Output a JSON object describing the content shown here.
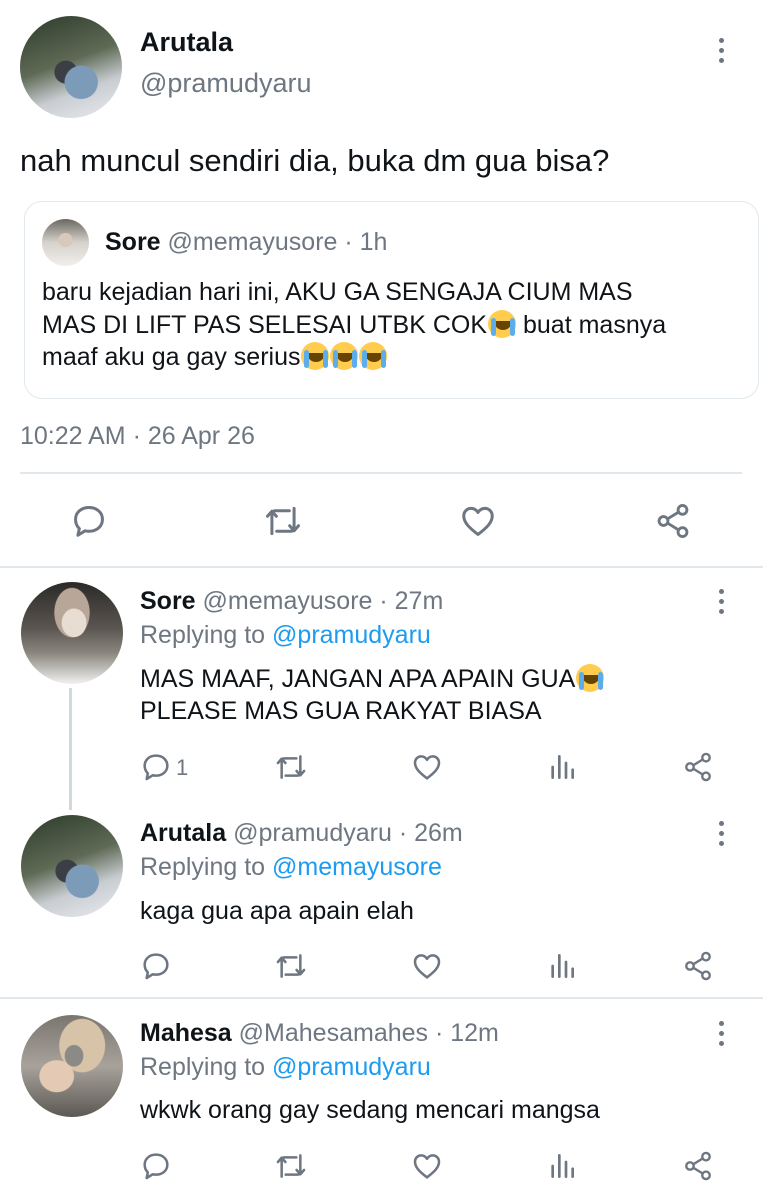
{
  "main_tweet": {
    "display_name": "Arutala",
    "handle": "@pramudyaru",
    "text": "nah muncul sendiri dia, buka dm gua bisa?",
    "quoted": {
      "display_name": "Sore",
      "handle_time": "@memayusore · 1h",
      "line1": "baru kejadian hari ini, AKU GA SENGAJA CIUM MAS",
      "line2a": "MAS DI LIFT PAS SELESAI UTBK COK",
      "line2b": " buat masnya",
      "line3": "maaf aku ga gay serius"
    },
    "timestamp": "10:22 AM · 26 Apr 26"
  },
  "replies": [
    {
      "display_name": "Sore",
      "handle_time": "@memayusore · 27m",
      "replying_prefix": "Replying to ",
      "replying_to": "@pramudyaru",
      "line1": "MAS MAAF, JANGAN APA APAIN GUA",
      "line2": "PLEASE MAS GUA RAKYAT BIASA",
      "reply_count": "1"
    },
    {
      "display_name": "Arutala",
      "handle_time": "@pramudyaru · 26m",
      "replying_prefix": "Replying to ",
      "replying_to": "@memayusore",
      "line1": "kaga gua apa apain elah"
    },
    {
      "display_name": "Mahesa",
      "handle_time": "@Mahesamahes · 12m",
      "replying_prefix": "Replying to ",
      "replying_to": "@pramudyaru",
      "line1": "wkwk orang gay sedang mencari mangsa"
    }
  ],
  "icons": {
    "reply": "comment-icon",
    "retweet": "retweet-icon",
    "like": "heart-icon",
    "share": "share-icon",
    "analytics": "analytics-icon",
    "more": "more-options-icon",
    "emoji": "loudly-crying-face-emoji"
  },
  "colors": {
    "text": "#0f1419",
    "secondary": "#6e7781",
    "link": "#1d9bf0",
    "divider": "#e1e8ed"
  }
}
